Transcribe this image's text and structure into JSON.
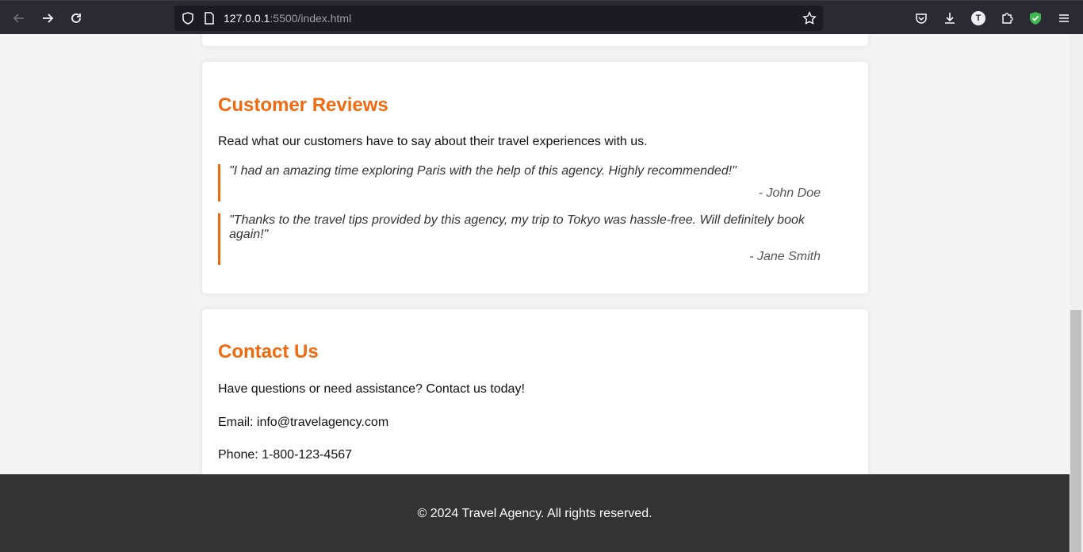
{
  "browser": {
    "url_host": "127.0.0.1",
    "url_path": ":5500/index.html",
    "icons": {
      "back": "back-arrow-icon",
      "forward": "forward-arrow-icon",
      "reload": "reload-icon",
      "shield": "shield-icon",
      "page": "page-icon",
      "bookmark": "star-icon",
      "pocket": "pocket-icon",
      "download": "download-icon",
      "account": "account-icon",
      "extensions": "extensions-icon",
      "adblock": "shield-check-icon",
      "menu": "hamburger-menu-icon"
    },
    "account_initial": "T"
  },
  "reviews": {
    "title": "Customer Reviews",
    "intro": "Read what our customers have to say about their travel experiences with us.",
    "items": [
      {
        "quote": "\"I had an amazing time exploring Paris with the help of this agency. Highly recommended!\"",
        "author": "- John Doe"
      },
      {
        "quote": "\"Thanks to the travel tips provided by this agency, my trip to Tokyo was hassle-free. Will definitely book again!\"",
        "author": "- Jane Smith"
      }
    ]
  },
  "contact": {
    "title": "Contact Us",
    "intro": "Have questions or need assistance? Contact us today!",
    "email": "Email: info@travelagency.com",
    "phone": "Phone: 1-800-123-4567"
  },
  "footer": {
    "text": "© 2024 Travel Agency. All rights reserved."
  },
  "colors": {
    "accent": "#f26a10",
    "footer_bg": "#333333",
    "toolbar_bg": "#2b2a33"
  }
}
